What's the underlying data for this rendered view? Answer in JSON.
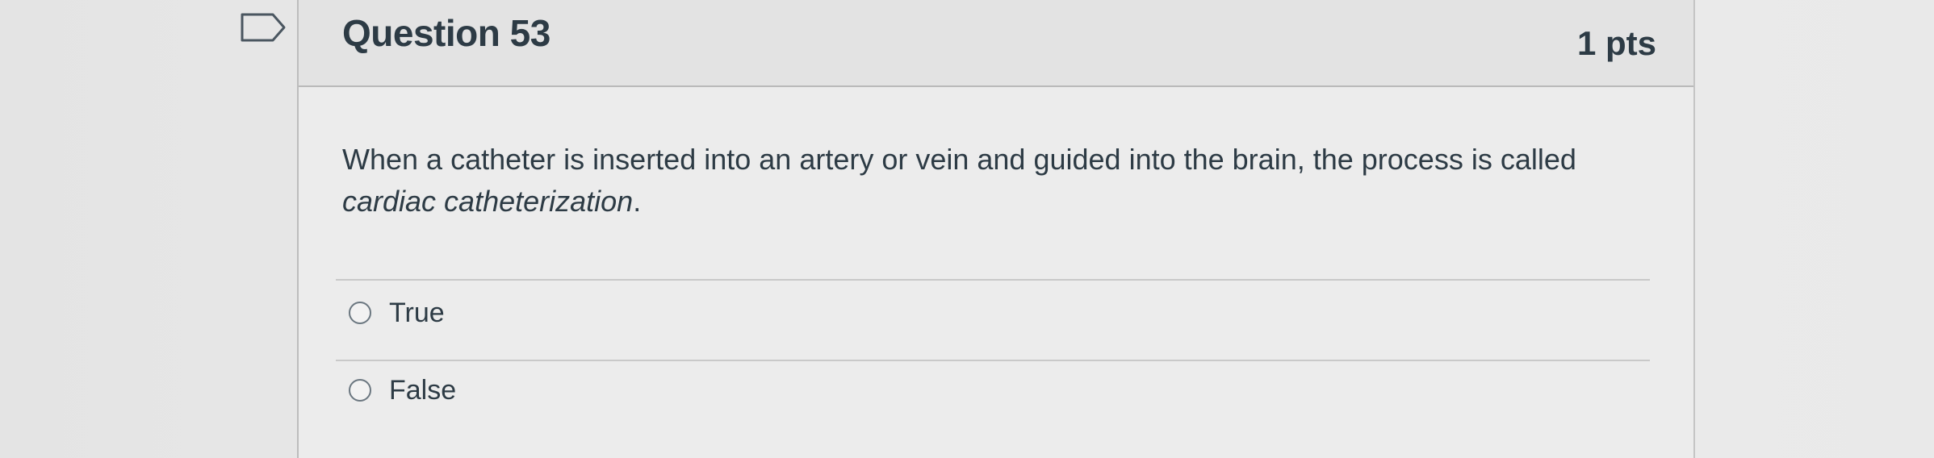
{
  "question": {
    "title": "Question 53",
    "points": "1 pts",
    "text_main": "When a catheter is inserted into an artery or vein and guided into the brain, the process is called",
    "text_italic": "cardiac catheterization",
    "text_end": "."
  },
  "answers": [
    {
      "label": "True"
    },
    {
      "label": "False"
    }
  ],
  "icons": {
    "flag": "flag-icon",
    "radio": "radio-button-icon"
  }
}
